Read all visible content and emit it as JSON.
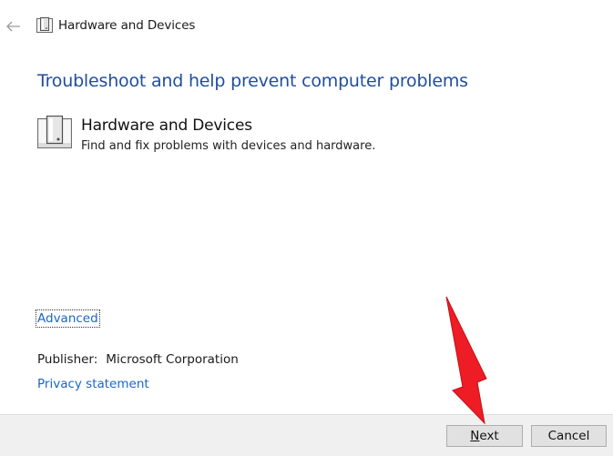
{
  "window": {
    "title": "Hardware and Devices"
  },
  "main": {
    "heading": "Troubleshoot and help prevent computer problems",
    "item": {
      "title": "Hardware and Devices",
      "description": "Find and fix problems with devices and hardware.",
      "icon": "hardware-devices-icon"
    },
    "advanced_link": "Advanced",
    "publisher_label": "Publisher:",
    "publisher_value": "Microsoft Corporation",
    "privacy_link": "Privacy statement"
  },
  "footer": {
    "next_accel": "N",
    "next_rest": "ext",
    "cancel_label": "Cancel"
  },
  "colors": {
    "heading": "#1f4e9c",
    "link": "#1a66c7",
    "annotation_arrow": "#ee1c24"
  }
}
